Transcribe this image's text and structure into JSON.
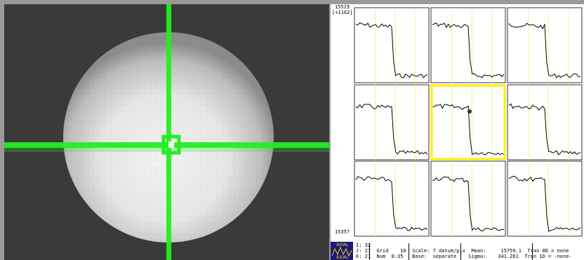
{
  "graph": {
    "y_top_value": "15519",
    "y_top_range": "[+1162]",
    "y_bottom_value": "15357"
  },
  "status": {
    "line1": "I: 32",
    "line2": "J: 27  Grid    10  Scale: 7 datum/pix  Mean:     15759.1  Tran 0D = none",
    "line3": "K: 21  Num  0:35   Base:  separate    Sigma:    341.261  Tran 1D = -none-"
  },
  "logo": {
    "top_label": "AXIAL",
    "bottom_label": "AXIAL"
  },
  "colors": {
    "crosshair": "#22ee22",
    "selected_frame": "#ffee00",
    "gridline": "#f2f2a0"
  }
}
